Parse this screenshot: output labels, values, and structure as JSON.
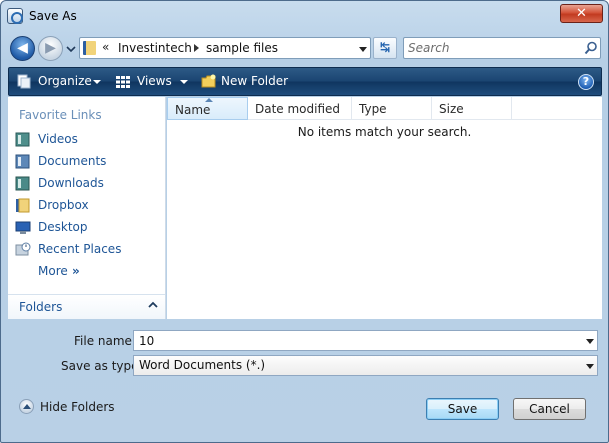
{
  "window": {
    "title": "Save As",
    "close_glyph": "✕"
  },
  "navigation": {
    "back_glyph": "◀",
    "forward_glyph": "▶",
    "breadcrumb_prefix": "«",
    "breadcrumb": [
      "Investintech",
      "sample files"
    ],
    "refresh_glyph": "↹",
    "search_placeholder": "Search"
  },
  "toolbar": {
    "organize_label": "Organize",
    "views_label": "Views",
    "new_folder_label": "New Folder",
    "help_glyph": "?"
  },
  "sidebar": {
    "heading": "Favorite Links",
    "items": [
      {
        "label": "Videos",
        "icon": "videos-icon"
      },
      {
        "label": "Documents",
        "icon": "documents-icon"
      },
      {
        "label": "Downloads",
        "icon": "downloads-icon"
      },
      {
        "label": "Dropbox",
        "icon": "dropbox-folder-icon"
      },
      {
        "label": "Desktop",
        "icon": "desktop-icon"
      },
      {
        "label": "Recent Places",
        "icon": "recent-places-icon"
      }
    ],
    "more_label": "More",
    "more_glyph": "»",
    "folders_label": "Folders"
  },
  "file_list": {
    "columns": [
      "Name",
      "Date modified",
      "Type",
      "Size"
    ],
    "empty_message": "No items match your search."
  },
  "form": {
    "file_name_label": "File name:",
    "file_name_value": "10",
    "save_as_type_label": "Save as type:",
    "save_as_type_value": "Word Documents (*.)"
  },
  "footer": {
    "hide_folders_label": "Hide Folders",
    "save_label": "Save",
    "cancel_label": "Cancel"
  },
  "colors": {
    "title_bar": "#b6cfe6",
    "command_bar": "#1a4471",
    "link_text": "#1e5596",
    "close_button": "#c23a20"
  }
}
